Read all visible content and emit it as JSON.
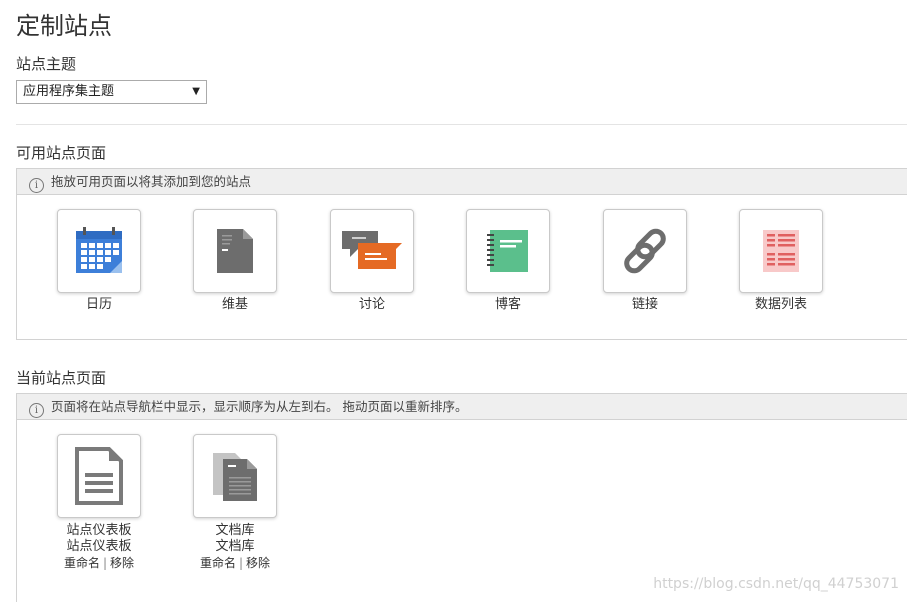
{
  "page": {
    "title": "定制站点"
  },
  "theme": {
    "label": "站点主题",
    "selected": "应用程序集主题"
  },
  "available": {
    "label": "可用站点页面",
    "hint": "拖放可用页面以将其添加到您的站点",
    "tiles": [
      {
        "label": "日历",
        "icon": "calendar-icon"
      },
      {
        "label": "维基",
        "icon": "wiki-page-icon"
      },
      {
        "label": "讨论",
        "icon": "discussion-icon"
      },
      {
        "label": "博客",
        "icon": "blog-icon"
      },
      {
        "label": "链接",
        "icon": "link-icon"
      },
      {
        "label": "数据列表",
        "icon": "data-list-icon"
      }
    ]
  },
  "current": {
    "label": "当前站点页面",
    "hint": "页面将在站点导航栏中显示，显示顺序为从左到右。 拖动页面以重新排序。",
    "tiles": [
      {
        "label": "站点仪表板",
        "sublabel": "站点仪表板",
        "rename": "重命名",
        "separator": "|",
        "remove": "移除",
        "icon": "dashboard-document-icon"
      },
      {
        "label": "文档库",
        "sublabel": "文档库",
        "rename": "重命名",
        "separator": "|",
        "remove": "移除",
        "icon": "document-library-icon"
      }
    ]
  },
  "watermark": "https://blog.csdn.net/qq_44753071",
  "colors": {
    "calendar": "#3d7fd9",
    "discussion": "#e56a24",
    "blog": "#5bbf8c",
    "datalist": "#f3a7a7",
    "wiki": "#6d6d6d"
  }
}
